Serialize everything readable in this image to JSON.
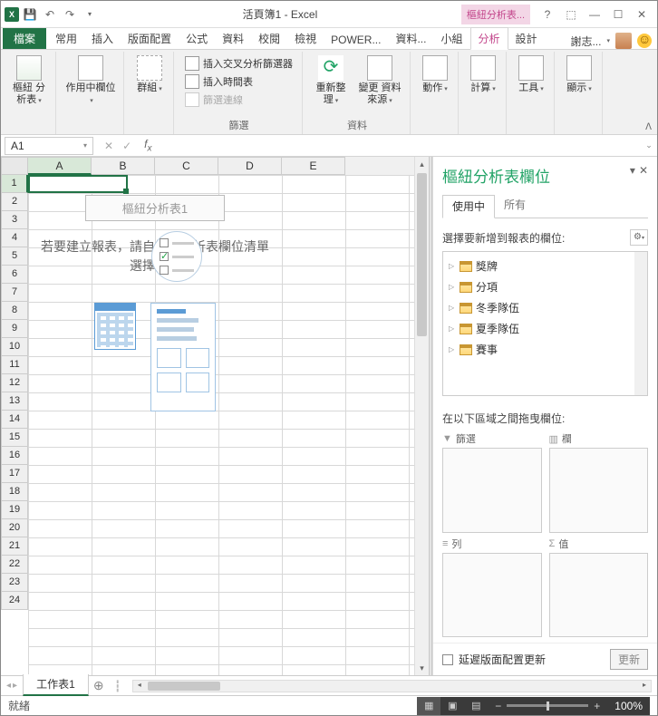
{
  "title": "活頁簿1 - Excel",
  "tool_context_tab": "樞紐分析表...",
  "help_icon": "?",
  "tabs": {
    "file": "檔案",
    "items": [
      "常用",
      "插入",
      "版面配置",
      "公式",
      "資料",
      "校閱",
      "檢視",
      "POWER...",
      "資料...",
      "小組"
    ],
    "context": [
      "分析",
      "設計"
    ],
    "user": "謝志..."
  },
  "ribbon": {
    "pivot": {
      "btn": "樞紐\n分析表",
      "group": ""
    },
    "active_field": {
      "btn": "作用中欄位",
      "group": ""
    },
    "group_btn": {
      "btn": "群組",
      "group": ""
    },
    "filter": {
      "slicer": "插入交叉分析篩選器",
      "timeline": "插入時間表",
      "connections": "篩選連線",
      "group": "篩選"
    },
    "refresh": {
      "btn": "重新整理",
      "group": ""
    },
    "change_source": {
      "btn": "變更\n資料來源",
      "group": "資料"
    },
    "actions": {
      "btn": "動作"
    },
    "calc": {
      "btn": "計算"
    },
    "tools": {
      "btn": "工具"
    },
    "show": {
      "btn": "顯示"
    }
  },
  "namebox": "A1",
  "columns": [
    "A",
    "B",
    "C",
    "D",
    "E"
  ],
  "rows_count": 24,
  "placeholder": {
    "title": "樞紐分析表1",
    "text": "若要建立報表，請自樞紐分析表欄位清單選擇欄位"
  },
  "pane": {
    "title": "樞紐分析表欄位",
    "tab_active": "使用中",
    "tab_all": "所有",
    "sub": "選擇要新增到報表的欄位:",
    "fields": [
      "獎牌",
      "分項",
      "冬季隊伍",
      "夏季隊伍",
      "賽事"
    ],
    "drag_label": "在以下區域之間拖曳欄位:",
    "area_filter": "篩選",
    "area_columns": "欄",
    "area_rows": "列",
    "area_values": "值",
    "defer": "延遲版面配置更新",
    "update": "更新"
  },
  "sheet": {
    "active": "工作表1"
  },
  "status": "就緒",
  "zoom": "100%"
}
